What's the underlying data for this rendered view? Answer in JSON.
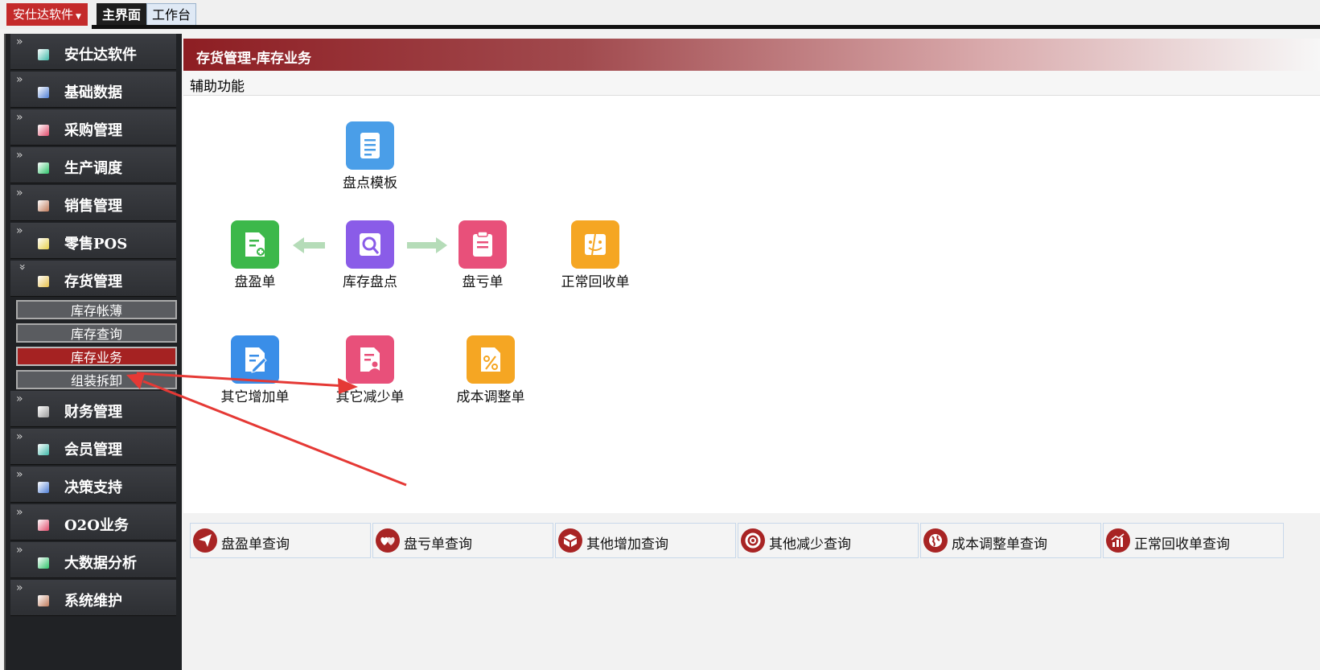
{
  "topbar": {
    "brand": "安仕达软件",
    "tabs": [
      "主界面",
      "工作台"
    ]
  },
  "sidebar": {
    "items": [
      {
        "label": "安仕达软件",
        "color": "#3fb8a8"
      },
      {
        "label": "基础数据",
        "color": "#4f7fd6"
      },
      {
        "label": "采购管理",
        "color": "#e04a6a"
      },
      {
        "label": "生产调度",
        "color": "#2ec46a"
      },
      {
        "label": "销售管理",
        "color": "#c07a5a"
      },
      {
        "label": "零售POS",
        "color": "#e6d04a"
      },
      {
        "label": "存货管理",
        "color": "#e6c04a"
      },
      {
        "label": "财务管理",
        "color": "#9a9a9a"
      },
      {
        "label": "会员管理",
        "color": "#3fb8a8"
      },
      {
        "label": "决策支持",
        "color": "#4f7fd6"
      },
      {
        "label": "O2O业务",
        "color": "#e04a6a"
      },
      {
        "label": "大数据分析",
        "color": "#2ec46a"
      },
      {
        "label": "系统维护",
        "color": "#c07a5a"
      }
    ],
    "subitems": [
      "库存帐薄",
      "库存查询",
      "库存业务",
      "组装拆卸"
    ],
    "active_sub": "库存业务"
  },
  "main": {
    "title": "存货管理-库存业务",
    "aux": "辅助功能",
    "flow": {
      "template": {
        "label": "盘点模板",
        "color": "#4a9ee8",
        "icon": "list-doc-icon"
      },
      "gain": {
        "label": "盘盈单",
        "color": "#3cb84a",
        "icon": "doc-plus-icon"
      },
      "count": {
        "label": "库存盘点",
        "color": "#8a5ce8",
        "icon": "magnifier-icon"
      },
      "loss": {
        "label": "盘亏单",
        "color": "#e8507a",
        "icon": "clipboard-icon"
      },
      "recycle": {
        "label": "正常回收单",
        "color": "#f5a623",
        "icon": "face-icon"
      },
      "other_add": {
        "label": "其它增加单",
        "color": "#3a8ee8",
        "icon": "doc-edit-icon"
      },
      "other_sub": {
        "label": "其它减少单",
        "color": "#e8507a",
        "icon": "doc-user-icon"
      },
      "cost_adj": {
        "label": "成本调整单",
        "color": "#f5a623",
        "icon": "percent-doc-icon"
      }
    },
    "queries": [
      {
        "label": "盘盈单查询",
        "icon": "paper-plane-icon"
      },
      {
        "label": "盘亏单查询",
        "icon": "hearts-icon"
      },
      {
        "label": "其他增加查询",
        "icon": "box-icon"
      },
      {
        "label": "其他减少查询",
        "icon": "lifebuoy-icon"
      },
      {
        "label": "成本调整单查询",
        "icon": "globe-icon"
      },
      {
        "label": "正常回收单查询",
        "icon": "bar-chart-icon"
      }
    ]
  }
}
